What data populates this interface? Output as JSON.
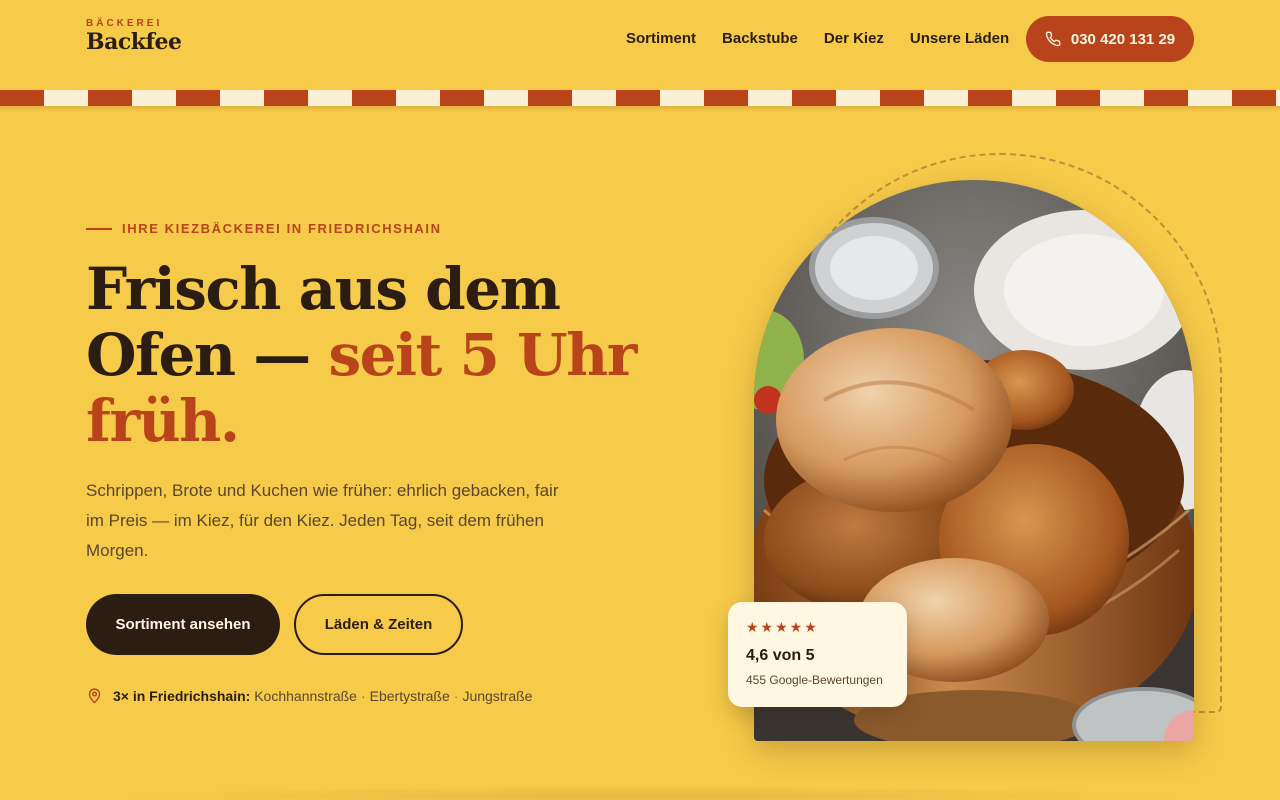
{
  "brand": {
    "eyebrow": "BÄCKEREI",
    "name": "Backfee"
  },
  "nav": {
    "items": [
      {
        "label": "Sortiment"
      },
      {
        "label": "Backstube"
      },
      {
        "label": "Der Kiez"
      },
      {
        "label": "Unsere Läden"
      }
    ],
    "phone": "030 420 131 29",
    "phone_icon": "phone-icon"
  },
  "colors": {
    "background": "#f6cb4a",
    "accent": "#b9441c",
    "dark": "#2b1d12",
    "cream": "#fff7e1"
  },
  "hero": {
    "eyebrow": "IHRE KIEZBÄCKEREI IN FRIEDRICHSHAIN",
    "headline_part1": "Frisch aus dem Ofen — ",
    "headline_accent": "seit 5 Uhr früh.",
    "lead": "Schrippen, Brote und Kuchen wie früher: ehrlich gebacken, fair im Preis — im Kiez, für den Kiez. Jeden Tag, seit dem frühen Morgen.",
    "primary_button": "Sortiment ansehen",
    "secondary_button": "Läden & Zeiten",
    "locations": {
      "icon": "map-pin-icon",
      "label": "3× in Friedrichshain:",
      "stores": [
        "Kochhannstraße",
        "Ebertystraße",
        "Jungstraße"
      ]
    }
  },
  "rating": {
    "stars": "★★★★★",
    "star_count": 5,
    "value": "4,6 von 5",
    "count": "455 Google-Bewertungen"
  }
}
